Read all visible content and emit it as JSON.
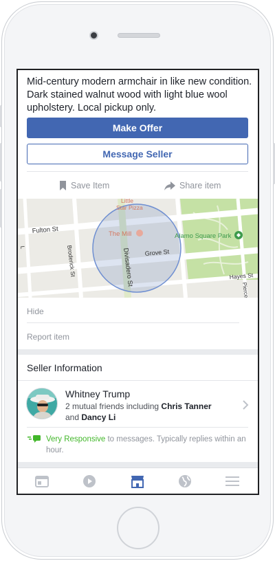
{
  "listing": {
    "description": "Mid-century modern armchair in like new condition. Dark stained walnut wood with light blue wool upholstery. Local pickup only.",
    "make_offer_label": "Make Offer",
    "message_seller_label": "Message Seller",
    "save_item_label": "Save Item",
    "share_item_label": "Share item"
  },
  "map": {
    "labels": {
      "fulton_st": "Fulton St",
      "broderick_st": "Broderick St",
      "divisadero_st": "Divisadero St",
      "grove_st": "Grove St",
      "hayes_st": "Hayes St",
      "the_mill": "The Mill",
      "little_star_pizza_1": "Little",
      "little_star_pizza_2": "Star Pizza",
      "alamo_square_park": "Alamo Square Park",
      "l_st": "L",
      "pierce_st": "Pierce"
    },
    "colors": {
      "park": "#c5e1a5",
      "radius": "#4267b2",
      "road": "#ffffff"
    }
  },
  "options": {
    "hide_label": "Hide",
    "report_label": "Report item"
  },
  "seller": {
    "section_title": "Seller Information",
    "name": "Whitney Trump",
    "mutual_prefix": "2 mutual friends including ",
    "mutual_friend_1": "Chris Tanner",
    "mutual_and": "and ",
    "mutual_friend_2": "Dancy Li",
    "responsive_label": "Very Responsive",
    "responsive_rest": " to messages. Typically replies within an hour."
  },
  "tabbar": {
    "tabs": [
      {
        "icon": "news-feed-icon",
        "active": false
      },
      {
        "icon": "video-icon",
        "active": false
      },
      {
        "icon": "marketplace-icon",
        "active": true
      },
      {
        "icon": "globe-icon",
        "active": false
      },
      {
        "icon": "menu-icon",
        "active": false
      }
    ],
    "active_color": "#4267b2",
    "inactive_color": "#bec2c9"
  }
}
